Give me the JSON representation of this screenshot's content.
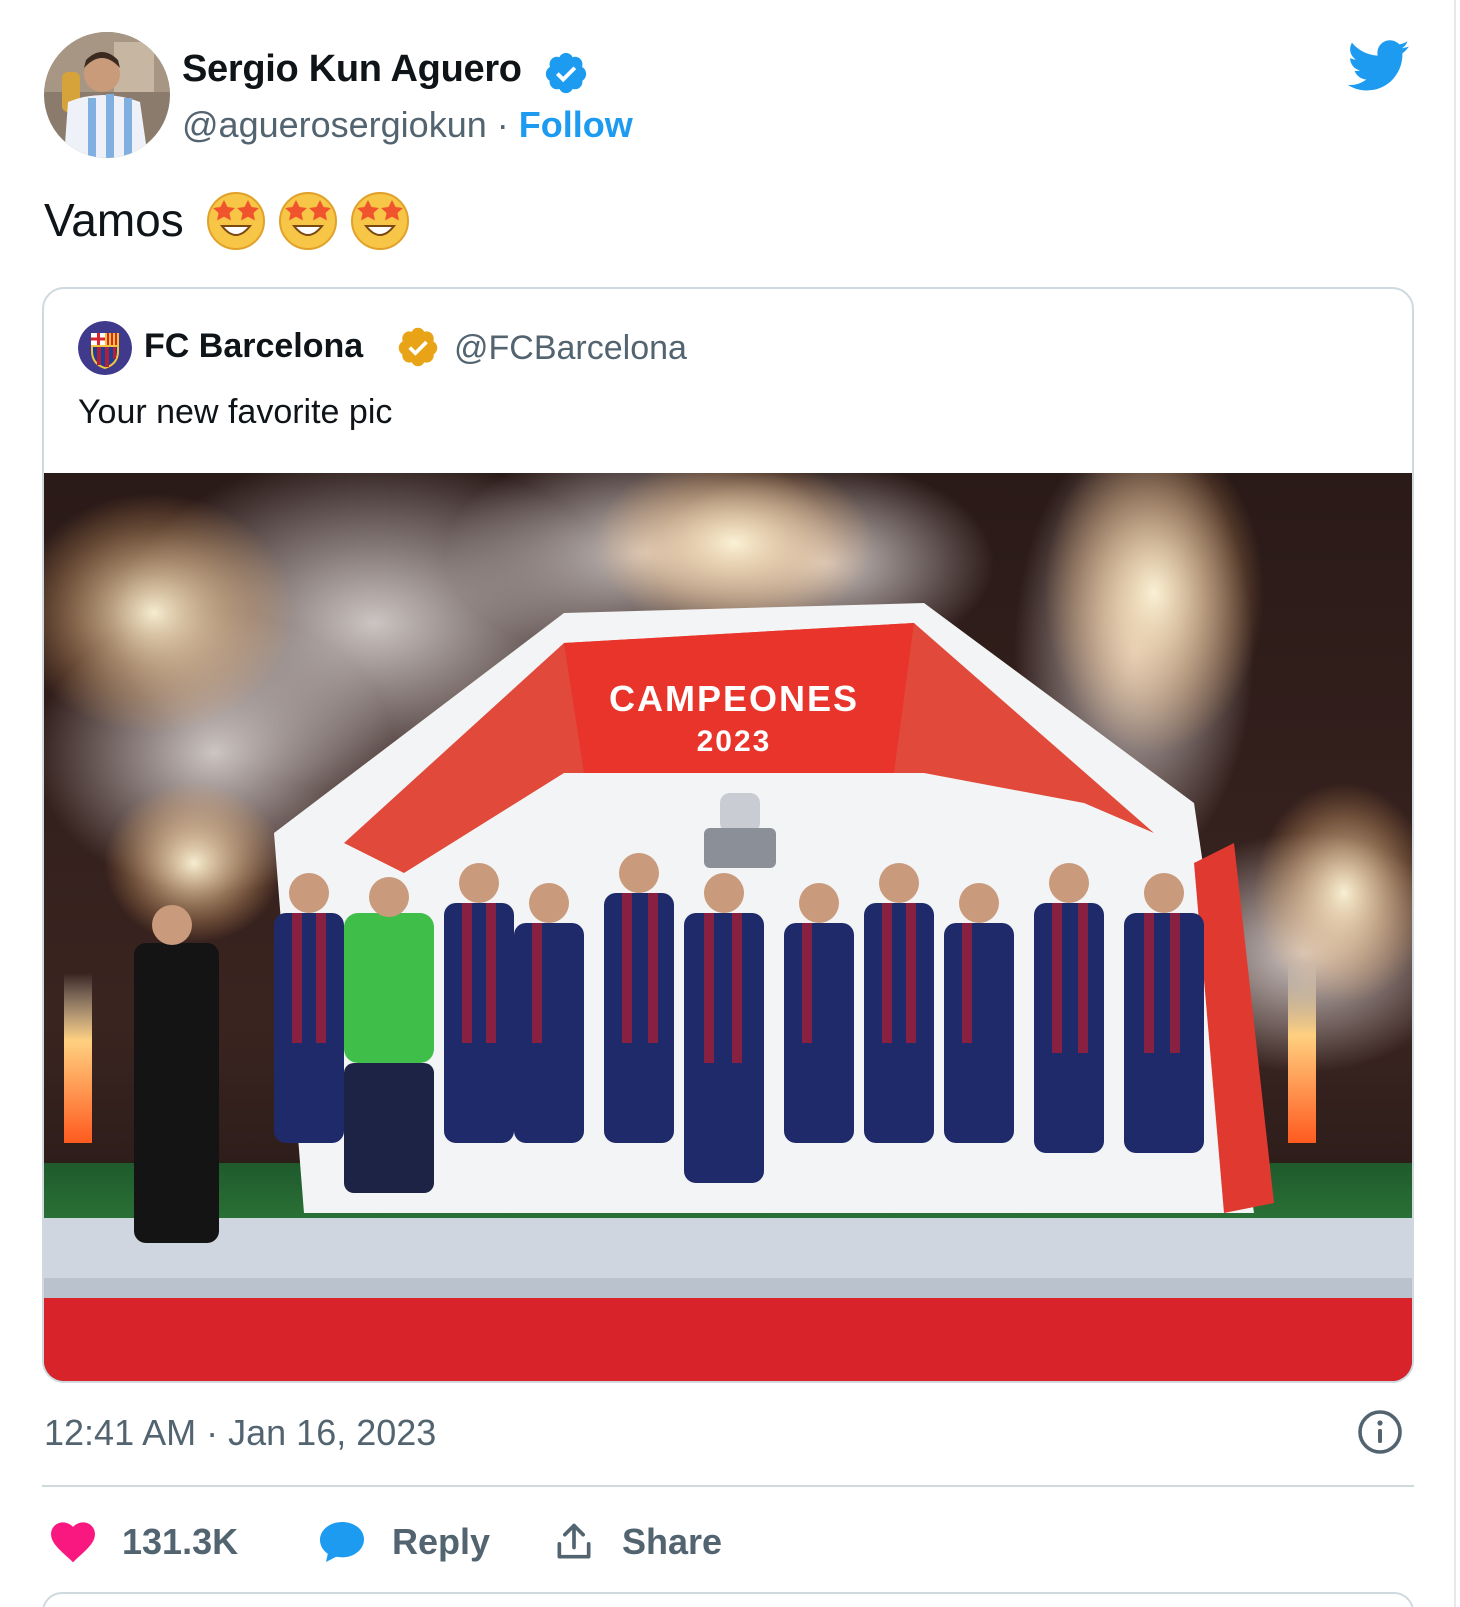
{
  "author": {
    "name": "Sergio Kun Aguero",
    "handle": "@aguerosergiokun",
    "separator": "·",
    "follow_label": "Follow",
    "verified_color": "#1d9bf0"
  },
  "tweet": {
    "text": "Vamos",
    "emojis": [
      "star-struck-emoji",
      "star-struck-emoji",
      "star-struck-emoji"
    ]
  },
  "quoted": {
    "name": "FC Barcelona",
    "handle": "@FCBarcelona",
    "text": "Your new favorite pic",
    "verified_color": "#e8a317",
    "image": {
      "banner_line1": "CAMPEONES",
      "banner_year": "2023"
    }
  },
  "meta": {
    "time": "12:41 AM",
    "separator": "·",
    "date": "Jan 16, 2023"
  },
  "actions": {
    "likes": "131.3K",
    "reply_label": "Reply",
    "share_label": "Share"
  },
  "colors": {
    "accent": "#1d9bf0",
    "like": "#f91880",
    "muted": "#536471"
  },
  "icons": {
    "brand": "twitter-bird-icon",
    "info": "info-icon",
    "like": "heart-icon",
    "reply": "speech-bubble-icon",
    "share": "share-upload-icon"
  }
}
